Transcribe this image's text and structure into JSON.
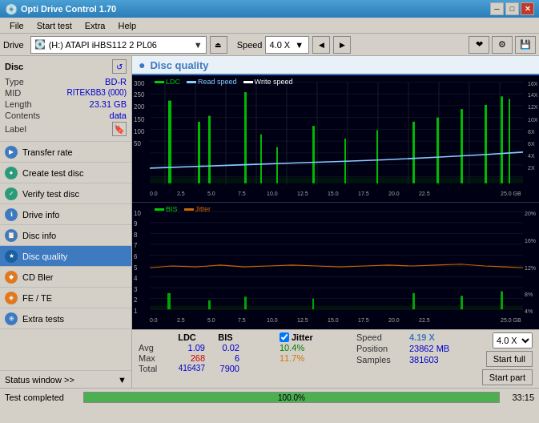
{
  "app": {
    "title": "Opti Drive Control 1.70",
    "icon": "💿"
  },
  "title_buttons": {
    "minimize": "─",
    "maximize": "□",
    "close": "✕"
  },
  "menu": {
    "items": [
      "File",
      "Start test",
      "Extra",
      "Help"
    ]
  },
  "drive": {
    "label": "Drive",
    "selected": "(H:)  ATAPI iHBS112  2 PL06",
    "speed_label": "Speed",
    "speed_value": "4.0 X"
  },
  "disc": {
    "title": "Disc",
    "type_label": "Type",
    "type_val": "BD-R",
    "mid_label": "MID",
    "mid_val": "RITEKBB3 (000)",
    "length_label": "Length",
    "length_val": "23.31 GB",
    "contents_label": "Contents",
    "contents_val": "data",
    "label_label": "Label"
  },
  "sidebar_items": [
    {
      "id": "transfer-rate",
      "label": "Transfer rate",
      "icon": "▶",
      "active": false
    },
    {
      "id": "create-test-disc",
      "label": "Create test disc",
      "icon": "●",
      "active": false
    },
    {
      "id": "verify-test-disc",
      "label": "Verify test disc",
      "icon": "✓",
      "active": false
    },
    {
      "id": "drive-info",
      "label": "Drive info",
      "icon": "ℹ",
      "active": false
    },
    {
      "id": "disc-info",
      "label": "Disc info",
      "icon": "📋",
      "active": false
    },
    {
      "id": "disc-quality",
      "label": "Disc quality",
      "icon": "★",
      "active": true
    },
    {
      "id": "cd-bler",
      "label": "CD Bler",
      "icon": "◆",
      "active": false
    },
    {
      "id": "fe-te",
      "label": "FE / TE",
      "icon": "◈",
      "active": false
    },
    {
      "id": "extra-tests",
      "label": "Extra tests",
      "icon": "⊕",
      "active": false
    }
  ],
  "status_window": {
    "label": "Status window >>",
    "icon": "▼"
  },
  "chart": {
    "title": "Disc quality",
    "icon": "●",
    "legend_ldc": "LDC",
    "legend_read": "Read speed",
    "legend_write": "Write speed",
    "legend_bis": "BIS",
    "legend_jitter": "Jitter",
    "y_max_top": 300,
    "y_max_bottom": 10,
    "x_max": 25
  },
  "stats": {
    "ldc_label": "LDC",
    "bis_label": "BIS",
    "jitter_label": "Jitter",
    "speed_label": "Speed",
    "position_label": "Position",
    "samples_label": "Samples",
    "avg_label": "Avg",
    "max_label": "Max",
    "total_label": "Total",
    "avg_ldc": "1.09",
    "avg_bis": "0.02",
    "avg_jitter": "10.4%",
    "max_ldc": "268",
    "max_bis": "6",
    "max_jitter": "11.7%",
    "total_ldc": "416437",
    "total_bis": "7900",
    "speed_val": "4.19 X",
    "position_val": "23862 MB",
    "samples_val": "381603",
    "start_full": "Start full",
    "start_part": "Start part",
    "speed_select": "4.0 X"
  },
  "bottom_status": {
    "text": "Test completed",
    "progress": 100,
    "progress_label": "100.0%",
    "time": "33:15"
  },
  "colors": {
    "ldc": "#00cc00",
    "read_speed": "#88ccff",
    "write_speed": "#ffffff",
    "bis": "#00cc00",
    "jitter": "#cc6600",
    "chart_bg": "#000014",
    "grid": "#333355",
    "accent": "#3d7abf"
  }
}
